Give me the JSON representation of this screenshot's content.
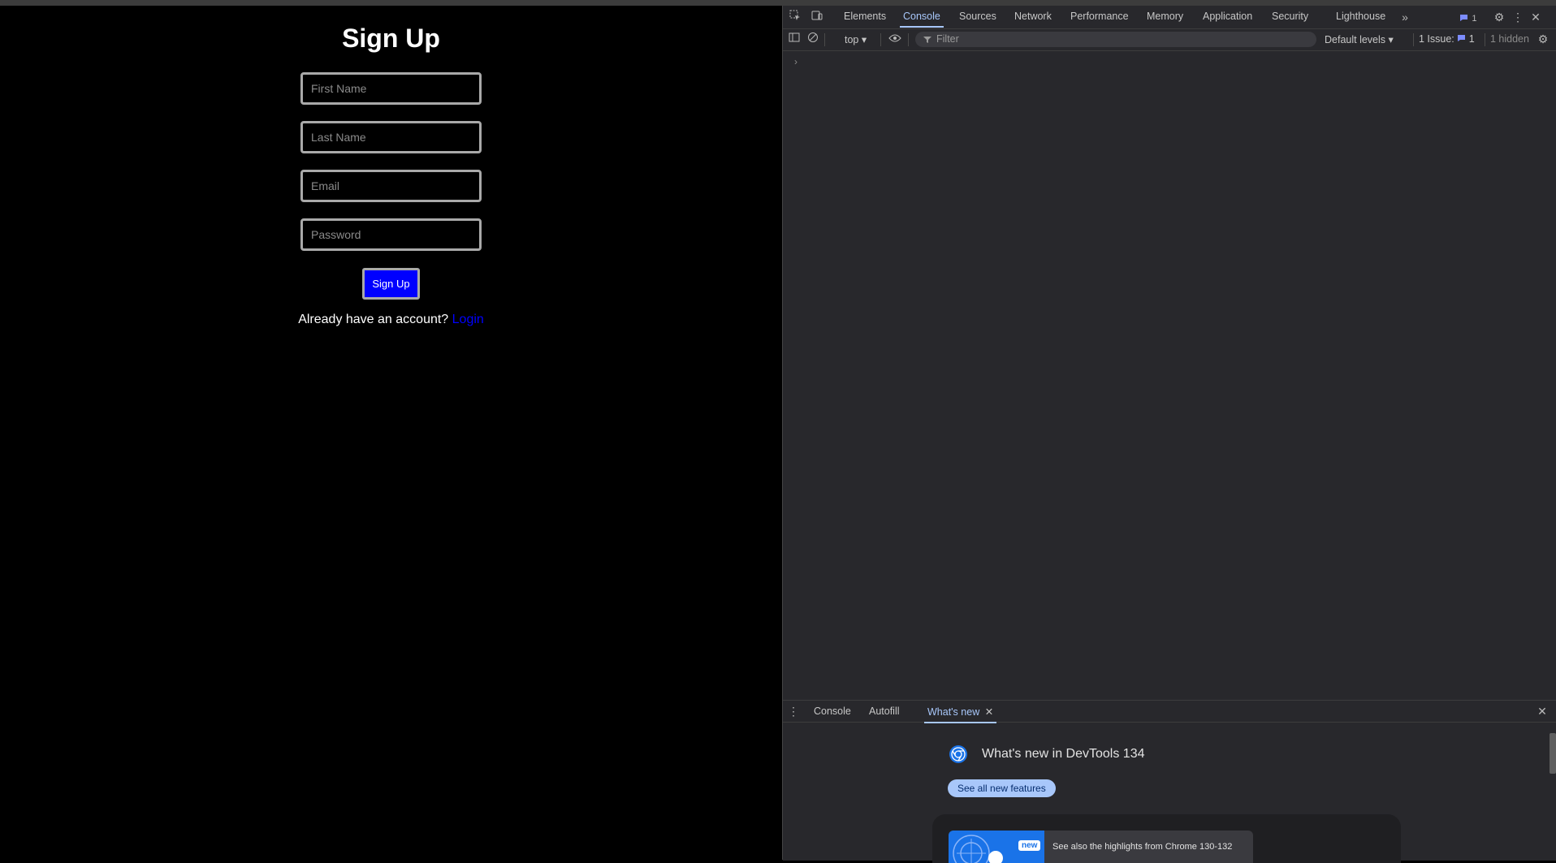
{
  "page": {
    "title": "Sign Up",
    "fields": {
      "first_name_placeholder": "First Name",
      "last_name_placeholder": "Last Name",
      "email_placeholder": "Email",
      "password_placeholder": "Password"
    },
    "submit_label": "Sign Up",
    "login_prompt": "Already have an account?",
    "login_link": "Login"
  },
  "devtools": {
    "tabs": [
      "Elements",
      "Console",
      "Sources",
      "Network",
      "Performance",
      "Memory",
      "Application",
      "Security",
      "Lighthouse"
    ],
    "active_tab": "Console",
    "issues_badge_count": "1",
    "toolbar": {
      "context": "top",
      "filter_placeholder": "Filter",
      "levels": "Default levels",
      "issues_label": "1 Issue:",
      "issues_count": "1",
      "hidden_label": "1 hidden"
    },
    "console_prompt": "›",
    "drawer": {
      "tabs": [
        "Console",
        "Autofill",
        "What's new"
      ],
      "active_tab": "What's new",
      "whats_new_title": "What's new in DevTools 134",
      "see_all_label": "See all new features",
      "new_badge": "new",
      "highlights_text": "See also the highlights from Chrome 130-132"
    }
  },
  "colors": {
    "page_bg": "#000000",
    "button_bg": "#0000ff",
    "link": "#0000ff",
    "devtools_bg": "#28282c",
    "devtools_accent": "#a8c7fa"
  }
}
